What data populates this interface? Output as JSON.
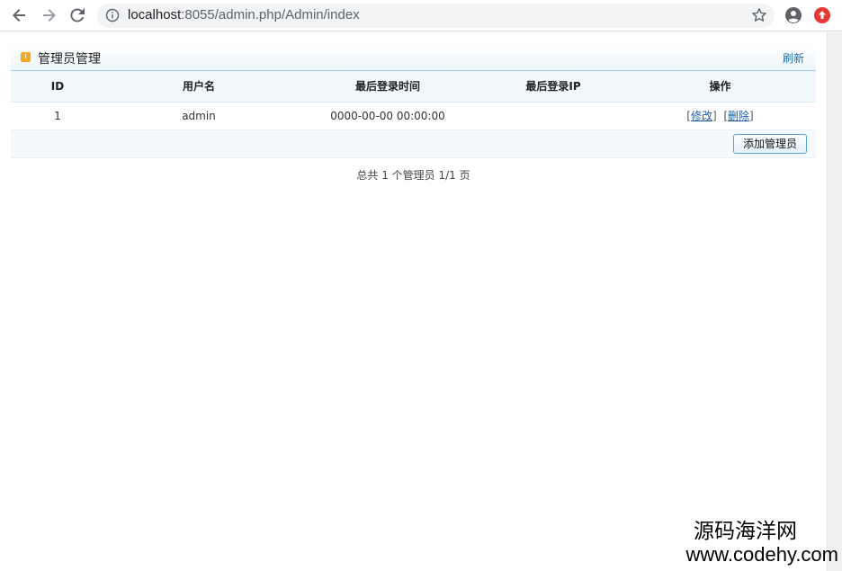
{
  "browser": {
    "url_host": "localhost",
    "url_rest": ":8055/admin.php/Admin/index"
  },
  "panel": {
    "title": "管理员管理",
    "refresh_label": "刷新"
  },
  "table": {
    "headers": [
      "ID",
      "用户名",
      "最后登录时间",
      "最后登录IP",
      "操作"
    ],
    "rows": [
      {
        "id": "1",
        "username": "admin",
        "last_login_time": "0000-00-00 00:00:00",
        "last_login_ip": "",
        "edit_label": "修改",
        "delete_label": "删除"
      }
    ]
  },
  "actions": {
    "add_label": "添加管理员"
  },
  "pager": {
    "text": "总共 1 个管理员 1/1 页"
  },
  "watermark": {
    "line1": "源码海洋网",
    "line2": "www.codehy.com"
  },
  "colors": {
    "accent": "#1f6fb5",
    "header_border": "#9ccbe3",
    "warn_icon": "#f5a623",
    "ext_icon": "#e53935"
  }
}
